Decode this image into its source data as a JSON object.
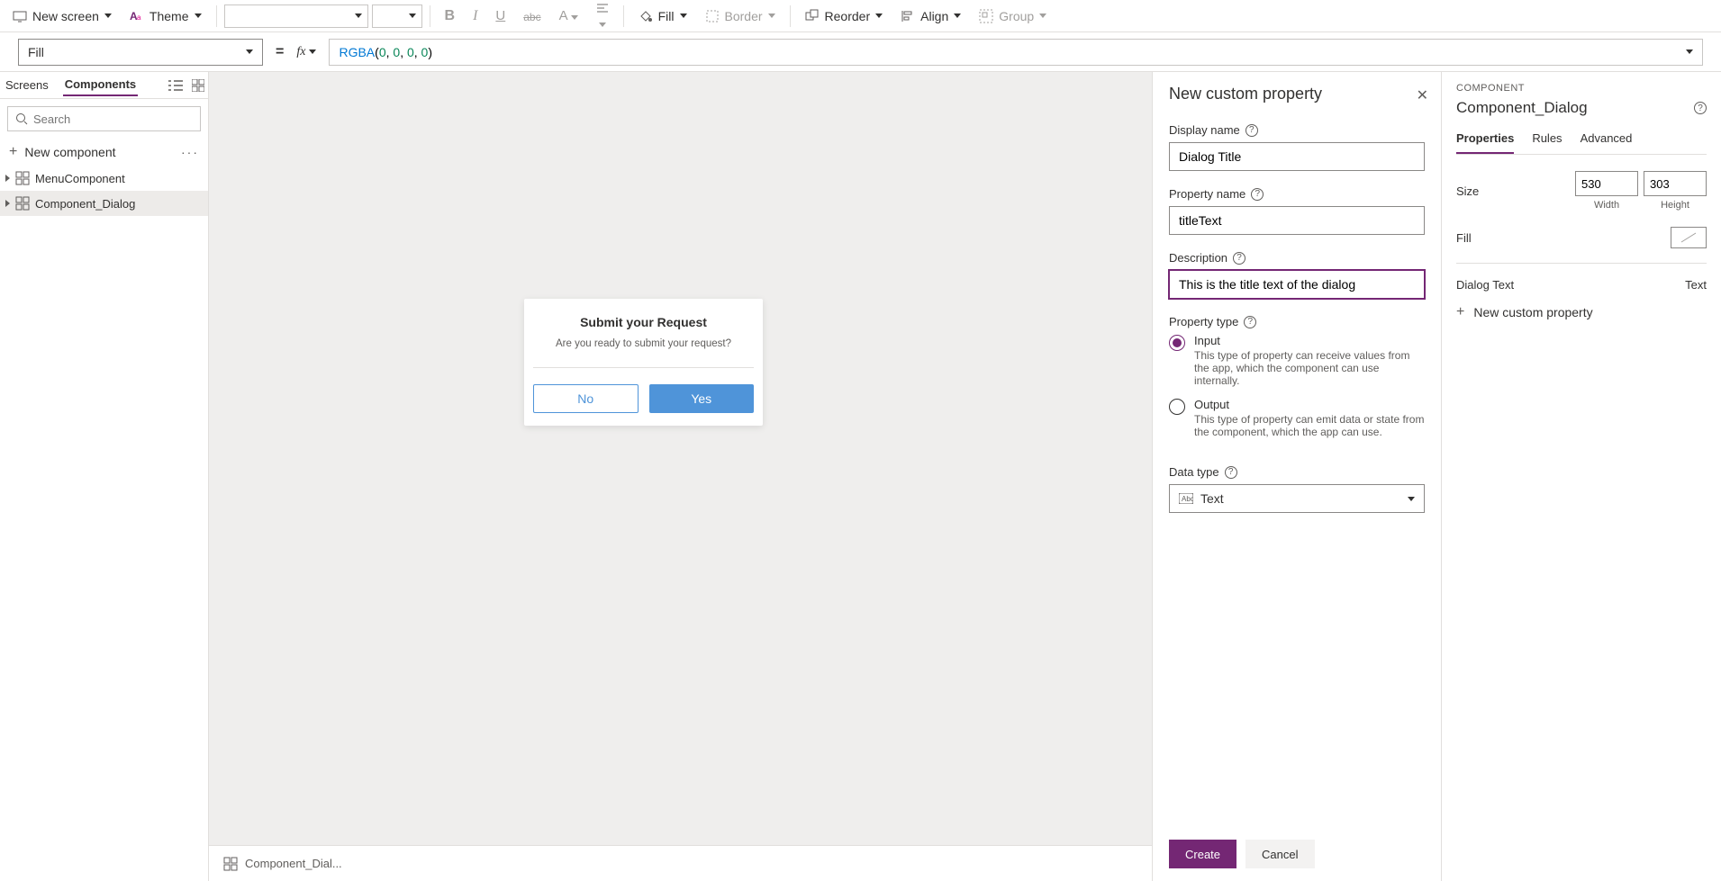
{
  "toolbar": {
    "new_screen": "New screen",
    "theme": "Theme",
    "fill": "Fill",
    "border": "Border",
    "reorder": "Reorder",
    "align": "Align",
    "group": "Group"
  },
  "formula": {
    "property": "Fill",
    "fx": "fx",
    "fn": "RGBA",
    "args": [
      "0",
      "0",
      "0",
      "0"
    ]
  },
  "left": {
    "tab_screens": "Screens",
    "tab_components": "Components",
    "search_placeholder": "Search",
    "new_component": "New component",
    "items": [
      {
        "label": "MenuComponent"
      },
      {
        "label": "Component_Dialog"
      }
    ]
  },
  "canvas": {
    "dialog_title": "Submit your Request",
    "dialog_text": "Are you ready to submit your request?",
    "btn_no": "No",
    "btn_yes": "Yes",
    "footer_breadcrumb": "Component_Dial..."
  },
  "panel": {
    "title": "New custom property",
    "display_name_label": "Display name",
    "display_name_value": "Dialog Title",
    "property_name_label": "Property name",
    "property_name_value": "titleText",
    "description_label": "Description",
    "description_value": "This is the title text of the dialog",
    "property_type_label": "Property type",
    "input_label": "Input",
    "input_desc": "This type of property can receive values from the app, which the component can use internally.",
    "output_label": "Output",
    "output_desc": "This type of property can emit data or state from the component, which the app can use.",
    "data_type_label": "Data type",
    "data_type_value": "Text",
    "create": "Create",
    "cancel": "Cancel"
  },
  "right": {
    "label": "COMPONENT",
    "title": "Component_Dialog",
    "tab_properties": "Properties",
    "tab_rules": "Rules",
    "tab_advanced": "Advanced",
    "size_label": "Size",
    "width": "530",
    "height": "303",
    "width_sub": "Width",
    "height_sub": "Height",
    "fill_label": "Fill",
    "dialog_text_label": "Dialog Text",
    "dialog_text_type": "Text",
    "add_prop": "New custom property"
  }
}
